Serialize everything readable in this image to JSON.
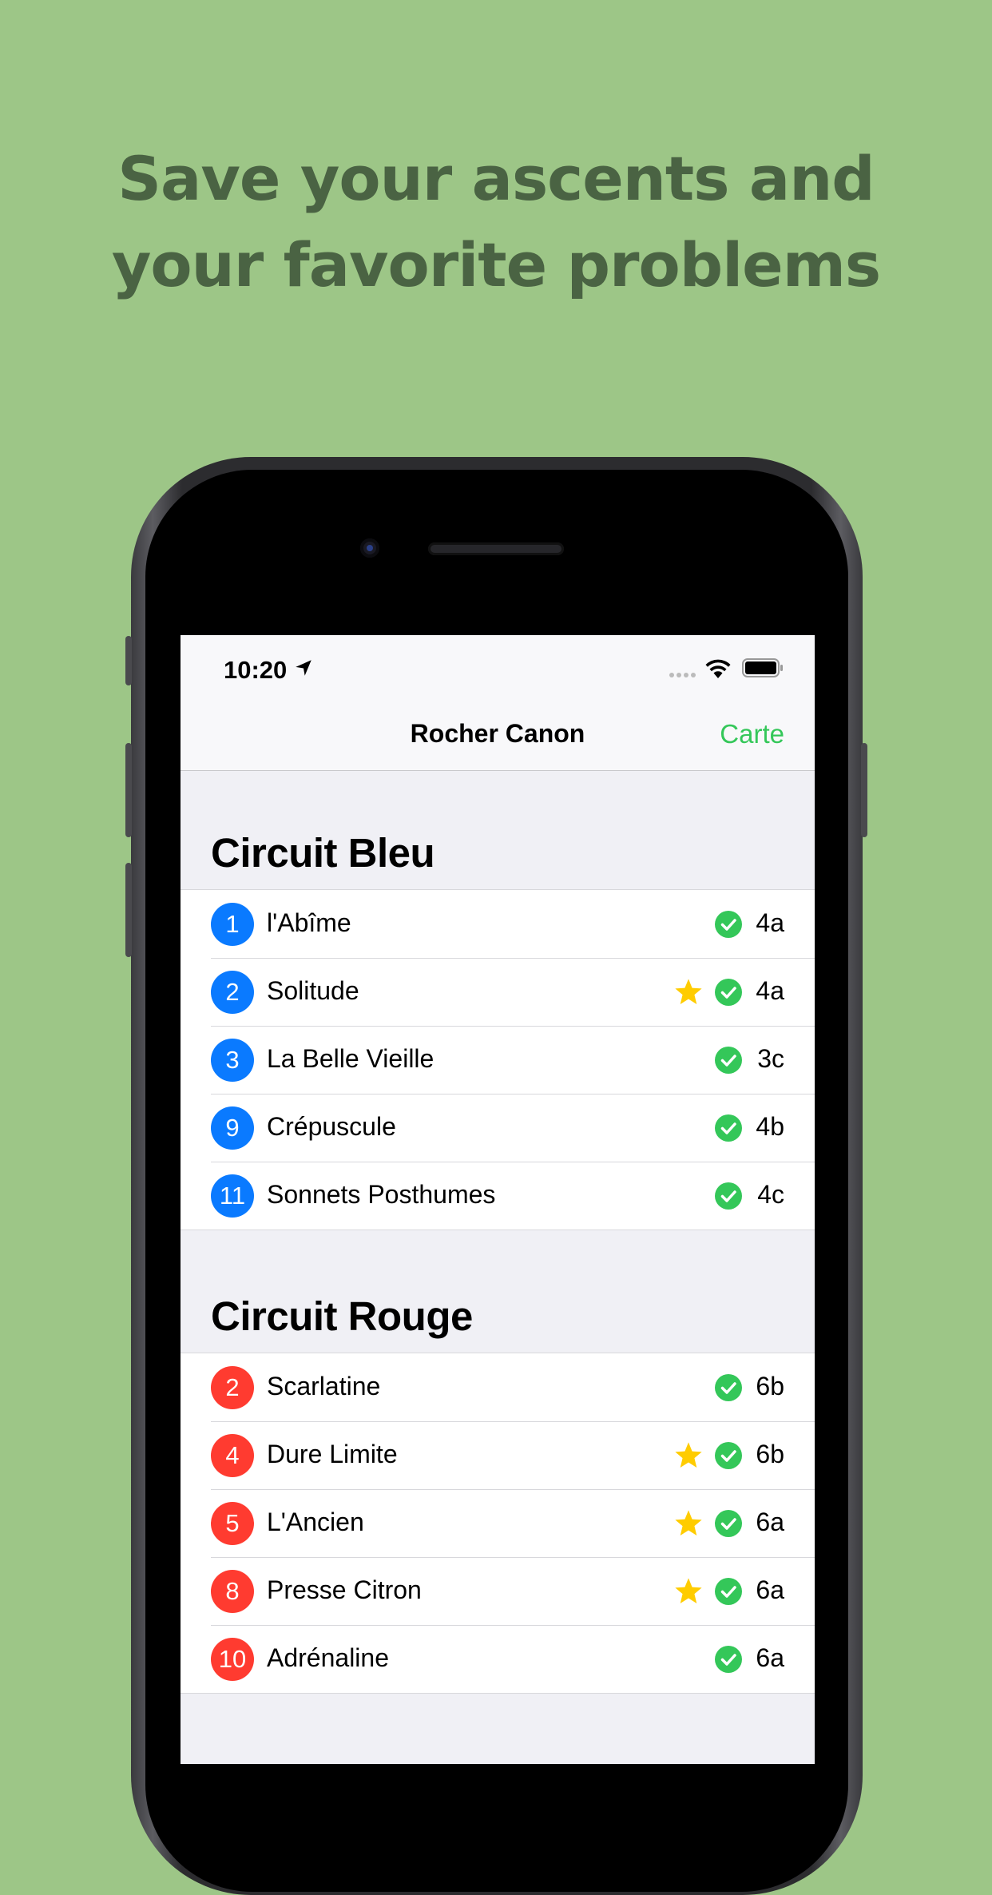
{
  "headline": {
    "line1": "Save your ascents and",
    "line2": "your favorite problems"
  },
  "status_bar": {
    "time": "10:20",
    "icons": [
      "location-arrow-icon",
      "cellular-signal-icon",
      "wifi-icon",
      "battery-icon"
    ]
  },
  "nav": {
    "title": "Rocher Canon",
    "map_button": "Carte"
  },
  "colors": {
    "background": "#9dc687",
    "headline": "#4a6343",
    "accent_green": "#34c759",
    "circuit_blue": "#0a7aff",
    "circuit_red": "#ff3b30",
    "star": "#ffcc00"
  },
  "sections": [
    {
      "title": "Circuit Bleu",
      "color": "blue",
      "problems": [
        {
          "number": "1",
          "name": "l'Abîme",
          "grade": "4a",
          "favorite": false,
          "ticked": true
        },
        {
          "number": "2",
          "name": "Solitude",
          "grade": "4a",
          "favorite": true,
          "ticked": true
        },
        {
          "number": "3",
          "name": "La Belle Vieille",
          "grade": "3c",
          "favorite": false,
          "ticked": true
        },
        {
          "number": "9",
          "name": "Crépuscule",
          "grade": "4b",
          "favorite": false,
          "ticked": true
        },
        {
          "number": "11",
          "name": "Sonnets Posthumes",
          "grade": "4c",
          "favorite": false,
          "ticked": true
        }
      ]
    },
    {
      "title": "Circuit Rouge",
      "color": "red",
      "problems": [
        {
          "number": "2",
          "name": "Scarlatine",
          "grade": "6b",
          "favorite": false,
          "ticked": true
        },
        {
          "number": "4",
          "name": "Dure Limite",
          "grade": "6b",
          "favorite": true,
          "ticked": true
        },
        {
          "number": "5",
          "name": "L'Ancien",
          "grade": "6a",
          "favorite": true,
          "ticked": true
        },
        {
          "number": "8",
          "name": "Presse Citron",
          "grade": "6a",
          "favorite": true,
          "ticked": true
        },
        {
          "number": "10",
          "name": "Adrénaline",
          "grade": "6a",
          "favorite": false,
          "ticked": true
        }
      ]
    }
  ]
}
